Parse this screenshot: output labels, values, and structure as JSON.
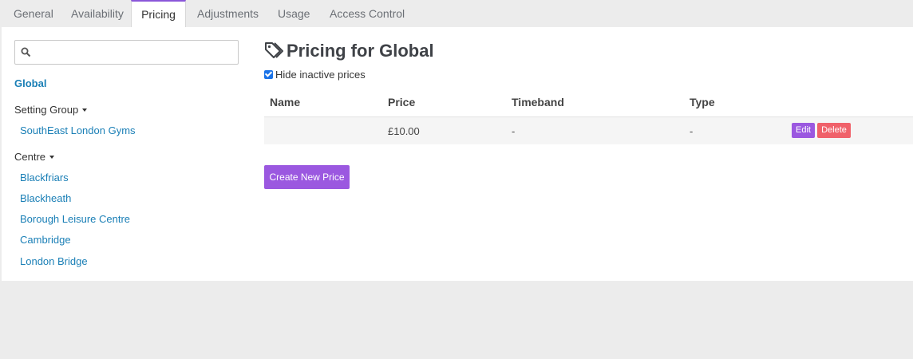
{
  "tabs": [
    "General",
    "Availability",
    "Pricing",
    "Adjustments",
    "Usage",
    "Access Control"
  ],
  "active_tab": "Pricing",
  "search": {
    "placeholder": "",
    "value": ""
  },
  "sidebar": {
    "global_label": "Global",
    "setting_group": {
      "label": "Setting Group",
      "items": [
        "SouthEast London Gyms"
      ]
    },
    "centre": {
      "label": "Centre",
      "items": [
        "Blackfriars",
        "Blackheath",
        "Borough Leisure Centre",
        "Cambridge",
        "London Bridge"
      ]
    }
  },
  "main": {
    "title": "Pricing for Global",
    "hide_inactive": {
      "label": "Hide inactive prices",
      "checked": true
    },
    "table": {
      "columns": [
        "Name",
        "Price",
        "Timeband",
        "Type"
      ],
      "rows": [
        {
          "name": "",
          "price": "£10.00",
          "timeband": "-",
          "type": "-",
          "edit": "Edit",
          "delete": "Delete"
        }
      ]
    },
    "create_button": "Create New Price"
  },
  "colors": {
    "accent": "#9b58e0",
    "danger": "#f0616a",
    "link": "#1a7fb6"
  }
}
